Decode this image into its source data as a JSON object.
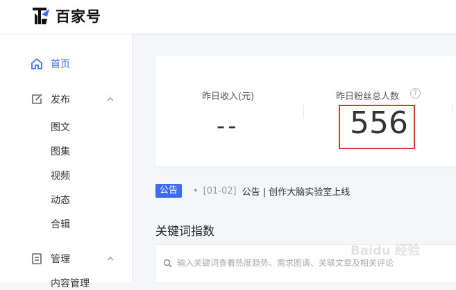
{
  "header": {
    "brand": "百家号"
  },
  "sidebar": {
    "home": "首页",
    "publish": {
      "label": "发布",
      "items": [
        "图文",
        "图集",
        "视频",
        "动态",
        "合辑"
      ]
    },
    "manage": {
      "label": "管理",
      "next_item": "内容管理"
    }
  },
  "stats": {
    "income_label": "昨日收入(元)",
    "income_value": "--",
    "fans_label": "昨日粉丝总人数",
    "fans_value": "556"
  },
  "notice": {
    "badge": "公告",
    "date": "[01-02]",
    "text": "公告 | 创作大脑实验室上线"
  },
  "keywords": {
    "title": "关键词指数",
    "placeholder": "输入关键词查看热度趋势、需求图谱、关联文章及相关评论"
  },
  "watermark": "Baidu 经验",
  "colors": {
    "accent": "#3d6cf0",
    "highlight": "#e0342c"
  }
}
